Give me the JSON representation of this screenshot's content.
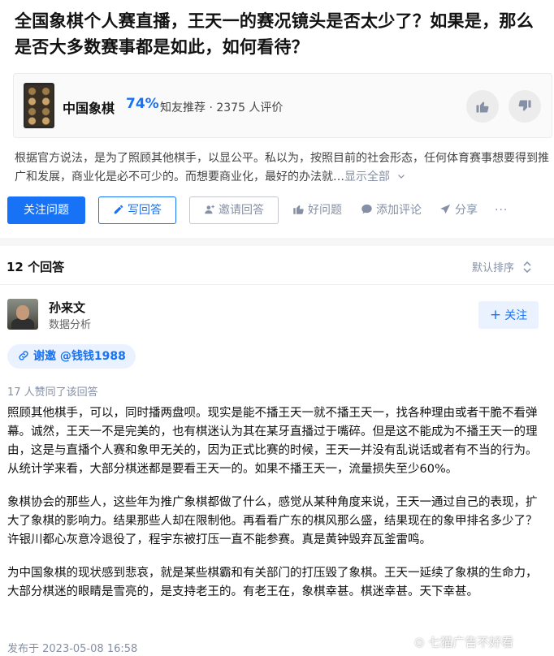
{
  "question": {
    "title": "全国象棋个人赛直播，王天一的赛况镜头是否太少了？如果是，那么是否大多数赛事都是如此，如何看待？"
  },
  "topic": {
    "name": "中国象棋",
    "percent": "74%",
    "recommend": "知友推荐 · 2375 人评价"
  },
  "excerpt": {
    "text": "根据官方说法，是为了照顾其他棋手，以显公平。私以为，按照目前的社会形态，任何体育赛事想要得到推广和发展，商业化是必不可少的。而想要商业化，最好的办法就…",
    "more": "显示全部"
  },
  "actions": {
    "follow_question": "关注问题",
    "write_answer": "写回答",
    "invite_answer": "邀请回答",
    "good_question": "好问题",
    "add_comment": "添加评论",
    "share": "分享",
    "more": "···"
  },
  "answers_header": {
    "count": "12 个回答",
    "sort": "默认排序"
  },
  "answer": {
    "author": "孙来文",
    "bio": "数据分析",
    "follow": "关注",
    "invite_prefix": "谢邀",
    "invite_user": "@钱钱1988",
    "upvotes": "17 人赞同了该回答",
    "paragraphs": [
      "照顾其他棋手，可以，同时播两盘呗。现实是能不播王天一就不播王天一，找各种理由或者干脆不看弹幕。诚然，王天一不是完美的，也有棋迷认为其在某牙直播过于嘴碎。但是这不能成为不播王天一的理由，这是与直播个人赛和象甲无关的，因为正式比赛的时候，王天一并没有乱说话或者有不当的行为。从统计学来看，大部分棋迷都是要看王天一的。如果不播王天一，流量损失至少60%。",
      "象棋协会的那些人，这些年为推广象棋都做了什么，感觉从某种角度来说，王天一通过自己的表现，扩大了象棋的影响力。结果那些人却在限制他。再看看广东的棋风那么盛，结果现在的象甲排名多少了？许银川都心灰意冷退役了，程宇东被打压一直不能参赛。真是黄钟毁弃瓦釜雷鸣。",
      "为中国象棋的现状感到悲哀，就是某些棋霸和有关部门的打压毁了象棋。王天一延续了象棋的生命力，大部分棋迷的眼睛是雪亮的，是支持老王的。有老王在，象棋幸甚。棋迷幸甚。天下幸甚。"
    ],
    "posted": "发布于 2023-05-08 16:58"
  },
  "watermark": "七猫广告不好看",
  "colors": {
    "accent": "#1772f6",
    "muted": "#8590a6"
  }
}
